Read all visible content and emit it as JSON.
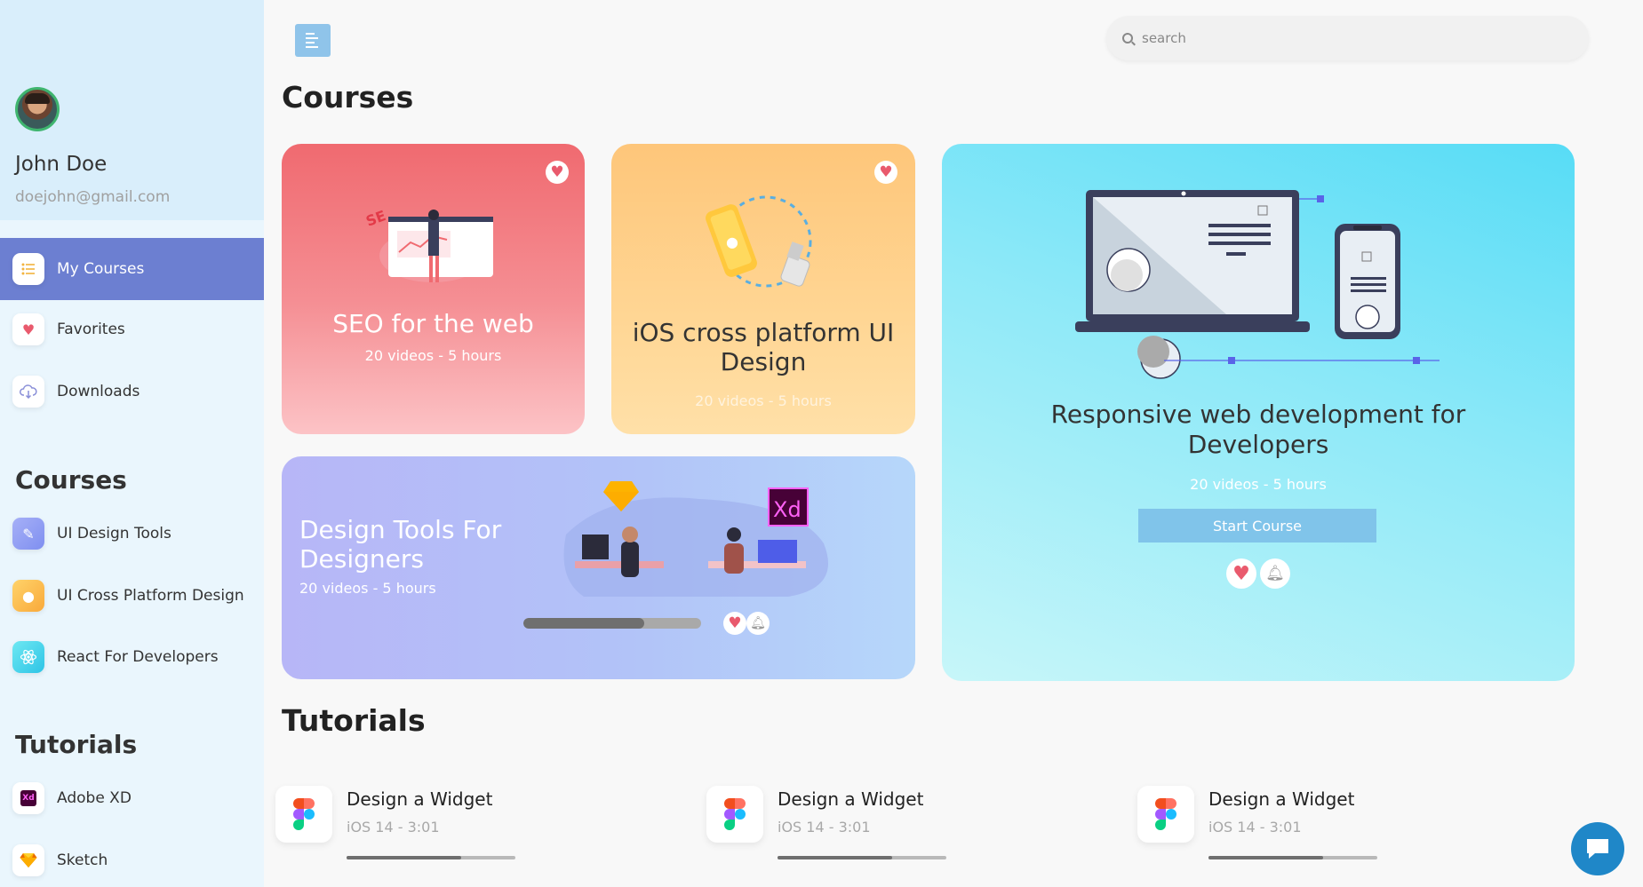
{
  "profile": {
    "name": "John Doe",
    "email": "doejohn@gmail.com"
  },
  "nav": {
    "my_courses": "My Courses",
    "favorites": "Favorites",
    "downloads": "Downloads"
  },
  "sidebar_courses": {
    "heading": "Courses",
    "items": [
      {
        "label": "UI Design Tools",
        "icon": "compass-icon"
      },
      {
        "label": "UI Cross Platform Design",
        "icon": "apple-icon"
      },
      {
        "label": "React For Developers",
        "icon": "react-icon"
      }
    ]
  },
  "sidebar_tutorials": {
    "heading": "Tutorials",
    "items": [
      {
        "label": "Adobe XD",
        "icon": "xd-icon",
        "badge": "Xd"
      },
      {
        "label": "Sketch",
        "icon": "sketch-icon"
      }
    ]
  },
  "search": {
    "placeholder": "search"
  },
  "main": {
    "courses_title": "Courses",
    "tutorials_title": "Tutorials"
  },
  "cards": {
    "seo": {
      "title": "SEO for the web",
      "meta": "20 videos - 5 hours"
    },
    "ios": {
      "title": "iOS cross platform UI Design",
      "meta": "20 videos - 5 hours"
    },
    "design": {
      "title": "Design Tools For Designers",
      "meta": "20 videos - 5 hours",
      "progress": 0.68,
      "xd_badge": "Xd"
    },
    "responsive": {
      "title": "Responsive web development for Developers",
      "meta": "20 videos - 5 hours",
      "button": "Start Course"
    }
  },
  "tutorials": [
    {
      "title": "Design a Widget",
      "meta": "iOS 14 - 3:01",
      "progress": 0.68
    },
    {
      "title": "Design a Widget",
      "meta": "iOS 14 - 3:01",
      "progress": 0.68
    },
    {
      "title": "Design a Widget",
      "meta": "iOS 14 - 3:01",
      "progress": 0.68
    }
  ],
  "colors": {
    "active_nav": "#6c7fd1",
    "heart": "#e95a6d",
    "chat": "#1f87c8",
    "seo_card": "#f06a70",
    "ios_card": "#fec67a",
    "design_card": "#b7b6f7",
    "responsive_card": "#57dcf6"
  }
}
